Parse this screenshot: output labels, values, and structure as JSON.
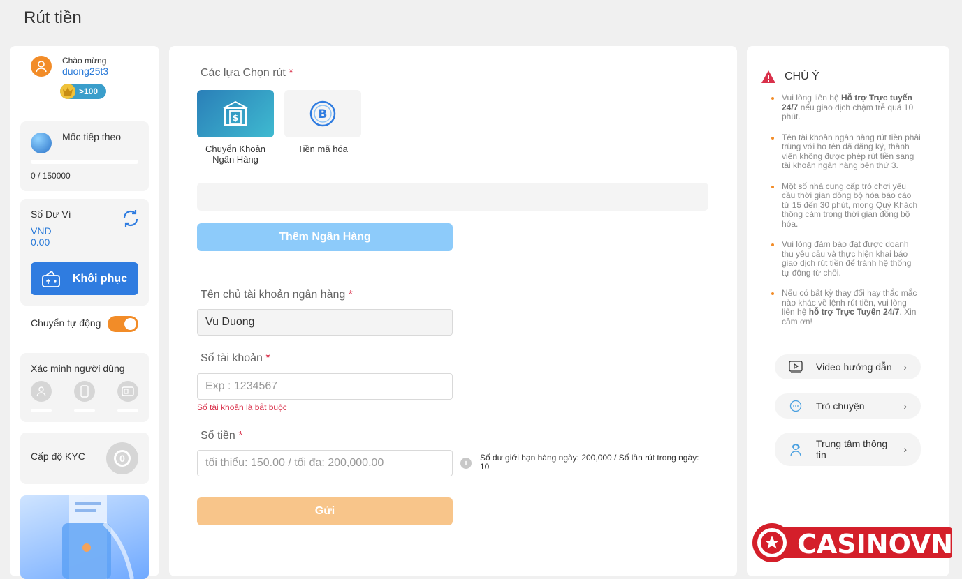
{
  "page": {
    "title": "Rút tiền"
  },
  "user": {
    "welcome": "Chào mừng",
    "username": "duong25t3",
    "vip_level": ">100"
  },
  "milestone": {
    "label": "Mốc tiếp theo",
    "progress": 0,
    "value": "0 / 150000"
  },
  "wallet": {
    "label": "Số Dư Ví",
    "currency": "VND",
    "amount": "0.00",
    "restore_label": "Khôi phục"
  },
  "auto_transfer": {
    "label": "Chuyển tự động",
    "enabled": true
  },
  "verify": {
    "label": "Xác minh người dùng"
  },
  "kyc": {
    "label": "Cấp độ KYC",
    "level": "0"
  },
  "form": {
    "options_label": "Các lựa Chọn rút",
    "options": [
      {
        "label": "Chuyển Khoản Ngân Hàng",
        "selected": true
      },
      {
        "label": "Tiền mã hóa",
        "selected": false
      }
    ],
    "add_bank": "Thêm Ngân Hàng",
    "holder_label": "Tên chủ tài khoản ngân hàng",
    "holder_value": "Vu Duong",
    "account_label": "Số tài khoản",
    "account_placeholder": "Exp : 1234567",
    "account_error": "Số tài khoản là bắt buộc",
    "amount_label": "Số tiền",
    "amount_placeholder": "tối thiểu: 150.00 / tối đa: 200,000.00",
    "limit_text": "Số dư giới hạn hàng ngày: 200,000 / Số lần rút trong ngày: 10",
    "submit": "Gửi",
    "required_mark": "*"
  },
  "notice": {
    "title": "CHÚ Ý",
    "n1_a": "Vui lòng liên hệ ",
    "n1_b": "Hỗ trợ Trực tuyến 24/7",
    "n1_c": " nếu giao dịch chậm trễ quá 10 phút.",
    "n2": "Tên tài khoản ngân hàng rút tiền phải trùng với họ tên đã đăng ký, thành viên không được phép rút tiền sang tài khoản ngân hàng bên thứ 3.",
    "n3": "Một số nhà cung cấp trò chơi yêu cầu thời gian đồng bộ hóa báo cáo từ 15 đến 30 phút, mong Quý Khách thông cảm trong thời gian đồng bộ hóa.",
    "n4": "Vui lòng đảm bảo đạt được doanh thu yêu cầu và thực hiện khai báo giao dịch rút tiền để tránh hệ thống tự động từ chối.",
    "n5_a": "Nếu có bất kỳ thay đổi hay thắc mắc nào khác về lệnh rút tiền, vui lòng liên hệ ",
    "n5_b": "hỗ trợ Trực Tuyến 24/7",
    "n5_c": ". Xin cảm ơn!"
  },
  "help": {
    "video": "Video hướng dẫn",
    "chat": "Trò chuyện",
    "info": "Trung tâm thông tin"
  },
  "brand": {
    "logo": "CASINOVN"
  },
  "colors": {
    "accent": "#f28c28",
    "primary": "#2f7ce0",
    "error": "#d9304a"
  }
}
